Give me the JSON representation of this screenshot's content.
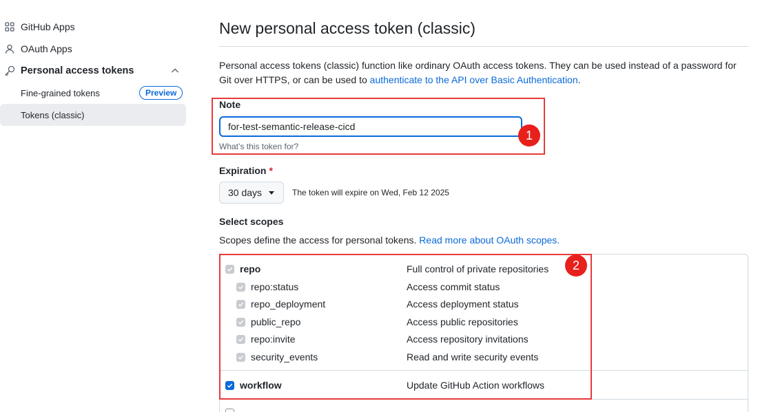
{
  "sidebar": {
    "items": [
      {
        "label": "GitHub Apps",
        "icon": "apps-grid-icon"
      },
      {
        "label": "OAuth Apps",
        "icon": "person-icon"
      },
      {
        "label": "Personal access tokens",
        "icon": "key-icon"
      }
    ],
    "subitems": [
      {
        "label": "Fine-grained tokens",
        "badge": "Preview"
      },
      {
        "label": "Tokens (classic)",
        "active": true
      }
    ]
  },
  "main": {
    "title": "New personal access token (classic)",
    "desc_text": "Personal access tokens (classic) function like ordinary OAuth access tokens. They can be used instead of a password for Git over HTTPS, or can be used to ",
    "desc_link": "authenticate to the API over Basic Authentication",
    "desc_end": ".",
    "note": {
      "label": "Note",
      "value": "for-test-semantic-release-cicd",
      "hint": "What’s this token for?"
    },
    "expiration": {
      "label": "Expiration",
      "required_mark": "*",
      "selected": "30 days",
      "note": "The token will expire on Wed, Feb 12 2025"
    },
    "scopes": {
      "label": "Select scopes",
      "desc_text": "Scopes define the access for personal tokens.",
      "desc_link": "Read more about OAuth scopes.",
      "rows": [
        {
          "name": "repo",
          "desc": "Full control of private repositories"
        },
        {
          "name": "repo:status",
          "desc": "Access commit status"
        },
        {
          "name": "repo_deployment",
          "desc": "Access deployment status"
        },
        {
          "name": "public_repo",
          "desc": "Access public repositories"
        },
        {
          "name": "repo:invite",
          "desc": "Access repository invitations"
        },
        {
          "name": "security_events",
          "desc": "Read and write security events"
        },
        {
          "name": "workflow",
          "desc": "Update GitHub Action workflows"
        }
      ]
    }
  },
  "annotations": [
    "1",
    "2"
  ],
  "colors": {
    "accent": "#0969da",
    "annotation": "#e8393a"
  }
}
